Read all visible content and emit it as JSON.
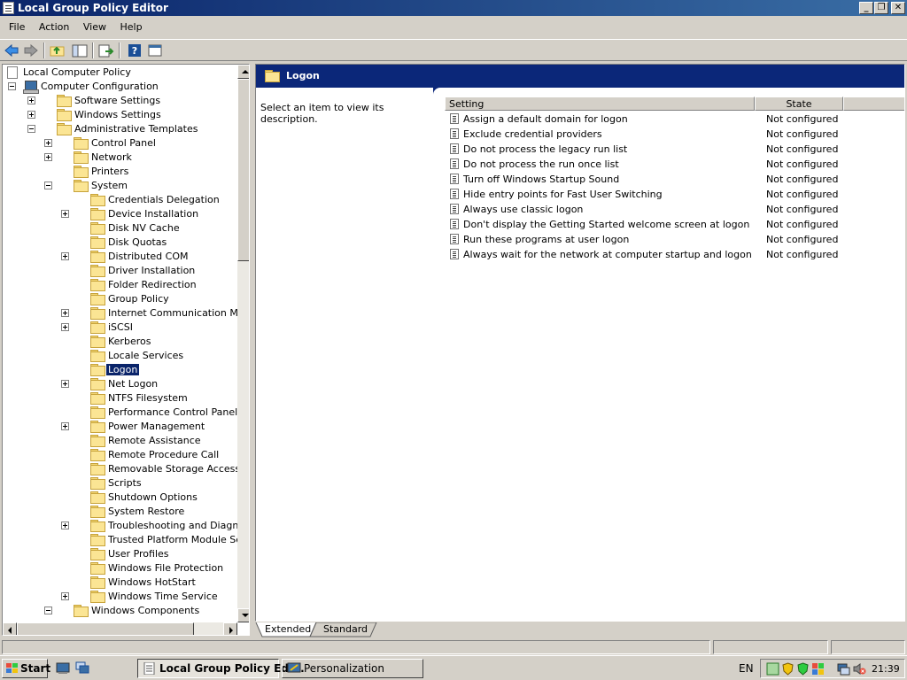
{
  "window": {
    "title": "Local Group Policy Editor"
  },
  "menu": [
    "File",
    "Action",
    "View",
    "Help"
  ],
  "tree": {
    "nodes": [
      {
        "label": "Local Computer Policy",
        "level": 0,
        "expander": "none",
        "icon": "doc"
      },
      {
        "label": "Computer Configuration",
        "level": 1,
        "expander": "minus",
        "icon": "computer"
      },
      {
        "label": "Software Settings",
        "level": 2,
        "expander": "plus",
        "icon": "folder"
      },
      {
        "label": "Windows Settings",
        "level": 2,
        "expander": "plus",
        "icon": "folder"
      },
      {
        "label": "Administrative Templates",
        "level": 2,
        "expander": "minus",
        "icon": "folder"
      },
      {
        "label": "Control Panel",
        "level": 3,
        "expander": "plus",
        "icon": "folder"
      },
      {
        "label": "Network",
        "level": 3,
        "expander": "plus",
        "icon": "folder"
      },
      {
        "label": "Printers",
        "level": 3,
        "expander": "none",
        "icon": "folder"
      },
      {
        "label": "System",
        "level": 3,
        "expander": "minus",
        "icon": "folder"
      },
      {
        "label": "Credentials Delegation",
        "level": 4,
        "expander": "none",
        "icon": "folder"
      },
      {
        "label": "Device Installation",
        "level": 4,
        "expander": "plus",
        "icon": "folder"
      },
      {
        "label": "Disk NV Cache",
        "level": 4,
        "expander": "none",
        "icon": "folder"
      },
      {
        "label": "Disk Quotas",
        "level": 4,
        "expander": "none",
        "icon": "folder"
      },
      {
        "label": "Distributed COM",
        "level": 4,
        "expander": "plus",
        "icon": "folder"
      },
      {
        "label": "Driver Installation",
        "level": 4,
        "expander": "none",
        "icon": "folder"
      },
      {
        "label": "Folder Redirection",
        "level": 4,
        "expander": "none",
        "icon": "folder"
      },
      {
        "label": "Group Policy",
        "level": 4,
        "expander": "none",
        "icon": "folder"
      },
      {
        "label": "Internet Communication Manageme",
        "level": 4,
        "expander": "plus",
        "icon": "folder"
      },
      {
        "label": "iSCSI",
        "level": 4,
        "expander": "plus",
        "icon": "folder"
      },
      {
        "label": "Kerberos",
        "level": 4,
        "expander": "none",
        "icon": "folder"
      },
      {
        "label": "Locale Services",
        "level": 4,
        "expander": "none",
        "icon": "folder"
      },
      {
        "label": "Logon",
        "level": 4,
        "expander": "none",
        "icon": "folder",
        "selected": true
      },
      {
        "label": "Net Logon",
        "level": 4,
        "expander": "plus",
        "icon": "folder"
      },
      {
        "label": "NTFS Filesystem",
        "level": 4,
        "expander": "none",
        "icon": "folder"
      },
      {
        "label": "Performance Control Panel",
        "level": 4,
        "expander": "none",
        "icon": "folder"
      },
      {
        "label": "Power Management",
        "level": 4,
        "expander": "plus",
        "icon": "folder"
      },
      {
        "label": "Remote Assistance",
        "level": 4,
        "expander": "none",
        "icon": "folder"
      },
      {
        "label": "Remote Procedure Call",
        "level": 4,
        "expander": "none",
        "icon": "folder"
      },
      {
        "label": "Removable Storage Access",
        "level": 4,
        "expander": "none",
        "icon": "folder"
      },
      {
        "label": "Scripts",
        "level": 4,
        "expander": "none",
        "icon": "folder"
      },
      {
        "label": "Shutdown Options",
        "level": 4,
        "expander": "none",
        "icon": "folder"
      },
      {
        "label": "System Restore",
        "level": 4,
        "expander": "none",
        "icon": "folder"
      },
      {
        "label": "Troubleshooting and Diagnostics",
        "level": 4,
        "expander": "plus",
        "icon": "folder"
      },
      {
        "label": "Trusted Platform Module Services",
        "level": 4,
        "expander": "none",
        "icon": "folder"
      },
      {
        "label": "User Profiles",
        "level": 4,
        "expander": "none",
        "icon": "folder"
      },
      {
        "label": "Windows File Protection",
        "level": 4,
        "expander": "none",
        "icon": "folder"
      },
      {
        "label": "Windows HotStart",
        "level": 4,
        "expander": "none",
        "icon": "folder"
      },
      {
        "label": "Windows Time Service",
        "level": 4,
        "expander": "plus",
        "icon": "folder"
      },
      {
        "label": "Windows Components",
        "level": 3,
        "expander": "minus",
        "icon": "folder"
      }
    ]
  },
  "detail": {
    "title": "Logon",
    "description": "Select an item to view its description.",
    "columns": {
      "setting": "Setting",
      "state": "State"
    },
    "rows": [
      {
        "setting": "Assign a default domain for logon",
        "state": "Not configured"
      },
      {
        "setting": "Exclude credential providers",
        "state": "Not configured"
      },
      {
        "setting": "Do not process the legacy run list",
        "state": "Not configured"
      },
      {
        "setting": "Do not process the run once list",
        "state": "Not configured"
      },
      {
        "setting": "Turn off Windows Startup Sound",
        "state": "Not configured"
      },
      {
        "setting": "Hide entry points for Fast User Switching",
        "state": "Not configured"
      },
      {
        "setting": "Always use classic logon",
        "state": "Not configured"
      },
      {
        "setting": "Don't display the Getting Started welcome screen at logon",
        "state": "Not configured"
      },
      {
        "setting": "Run these programs at user logon",
        "state": "Not configured"
      },
      {
        "setting": "Always wait for the network at computer startup and logon",
        "state": "Not configured"
      }
    ]
  },
  "tabs": {
    "extended": "Extended",
    "standard": "Standard"
  },
  "taskbar": {
    "start": "Start",
    "buttons": [
      {
        "label": "Local Group Policy Edi...",
        "active": true
      },
      {
        "label": "Personalization",
        "active": false
      }
    ],
    "language": "EN",
    "clock": "21:39"
  }
}
